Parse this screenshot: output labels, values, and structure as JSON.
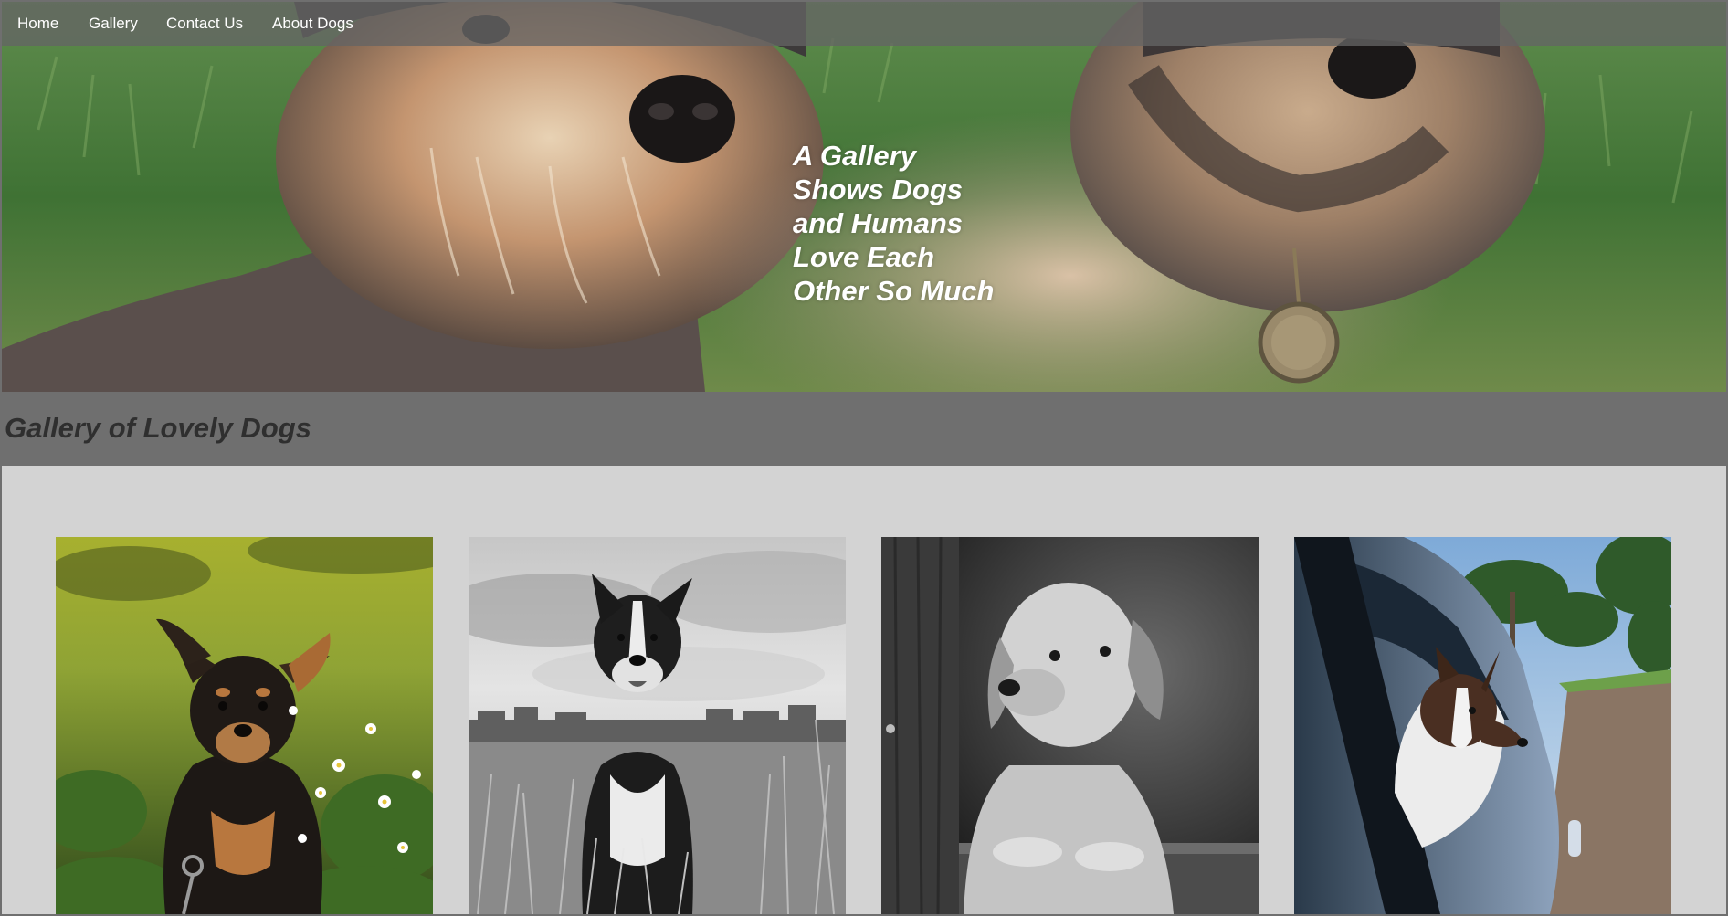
{
  "nav": {
    "items": [
      {
        "label": "Home"
      },
      {
        "label": "Gallery"
      },
      {
        "label": "Contact Us"
      },
      {
        "label": "About Dogs"
      }
    ]
  },
  "hero": {
    "heading_lines": [
      "A Gallery",
      "Shows Dogs",
      "and Humans",
      "Love Each",
      "Other So Much"
    ]
  },
  "gallery": {
    "title": "Gallery of Lovely Dogs",
    "photos": [
      {
        "subject": "black and tan small dog among daisies",
        "style": "color"
      },
      {
        "subject": "border collie standing in tall grass",
        "style": "black-and-white"
      },
      {
        "subject": "retriever resting on ledge",
        "style": "black-and-white"
      },
      {
        "subject": "border collie leaning out of car window",
        "style": "color"
      }
    ]
  },
  "colors": {
    "band": "#6f6f6f",
    "gallery_bg": "#d3d3d3",
    "title_text": "#2f2f2f",
    "nav_text": "#ffffff"
  }
}
